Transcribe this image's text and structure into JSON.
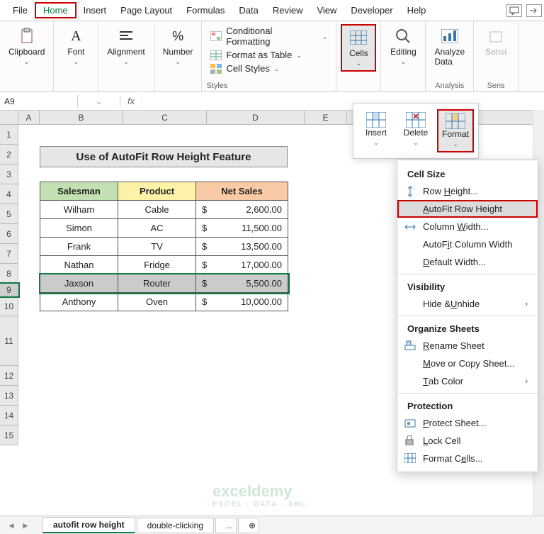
{
  "tabs": [
    "File",
    "Home",
    "Insert",
    "Page Layout",
    "Formulas",
    "Data",
    "Review",
    "View",
    "Developer",
    "Help"
  ],
  "ribbon": {
    "clipboard": "Clipboard",
    "font": "Font",
    "alignment": "Alignment",
    "number": "Number",
    "styles_label": "Styles",
    "styles_items": [
      "Conditional Formatting",
      "Format as Table",
      "Cell Styles"
    ],
    "cells": "Cells",
    "editing": "Editing",
    "analyze1": "Analyze",
    "analyze2": "Data",
    "analysis": "Analysis",
    "sensi": "Sensi",
    "sens": "Sens"
  },
  "name_box": "A9",
  "fx": "fx",
  "cols": [
    "A",
    "B",
    "C",
    "D",
    "E"
  ],
  "rows": [
    "1",
    "2",
    "3",
    "4",
    "5",
    "6",
    "7",
    "8",
    "9",
    "10",
    "11",
    "12",
    "13",
    "14",
    "15"
  ],
  "title": "Use of AutoFit Row Height Feature",
  "headers": {
    "salesman": "Salesman",
    "product": "Product",
    "netsales": "Net Sales"
  },
  "data": [
    {
      "s": "Wilham",
      "p": "Cable",
      "c": "$",
      "v": "2,600.00"
    },
    {
      "s": "Simon",
      "p": "AC",
      "c": "$",
      "v": "11,500.00"
    },
    {
      "s": "Frank",
      "p": "TV",
      "c": "$",
      "v": "13,500.00"
    },
    {
      "s": "Nathan",
      "p": "Fridge",
      "c": "$",
      "v": "17,000.00"
    },
    {
      "s": "Jaxson",
      "p": "Router",
      "c": "$",
      "v": "5,500.00"
    },
    {
      "s": "Anthony",
      "p": "Oven",
      "c": "$",
      "v": "10,000.00"
    }
  ],
  "cells_popup": {
    "insert": "Insert",
    "delete": "Delete",
    "format": "Format"
  },
  "format_menu": {
    "cell_size": "Cell Size",
    "row_height": "Row Height...",
    "autofit_row": "AutoFit Row Height",
    "col_width": "Column Width...",
    "autofit_col": "AutoFit Column Width",
    "default_width": "Default Width...",
    "visibility": "Visibility",
    "hide_unhide": "Hide & Unhide",
    "organize": "Organize Sheets",
    "rename": "Rename Sheet",
    "move_copy": "Move or Copy Sheet...",
    "tab_color": "Tab Color",
    "protection": "Protection",
    "protect": "Protect Sheet...",
    "lock": "Lock Cell",
    "format_cells": "Format Cells..."
  },
  "sheets": {
    "active": "autofit row height",
    "other": "double-clicking",
    "more": "...",
    "new": "+"
  },
  "watermark": {
    "brand": "exceldemy",
    "sub": "EXCEL · DATA · XML"
  }
}
